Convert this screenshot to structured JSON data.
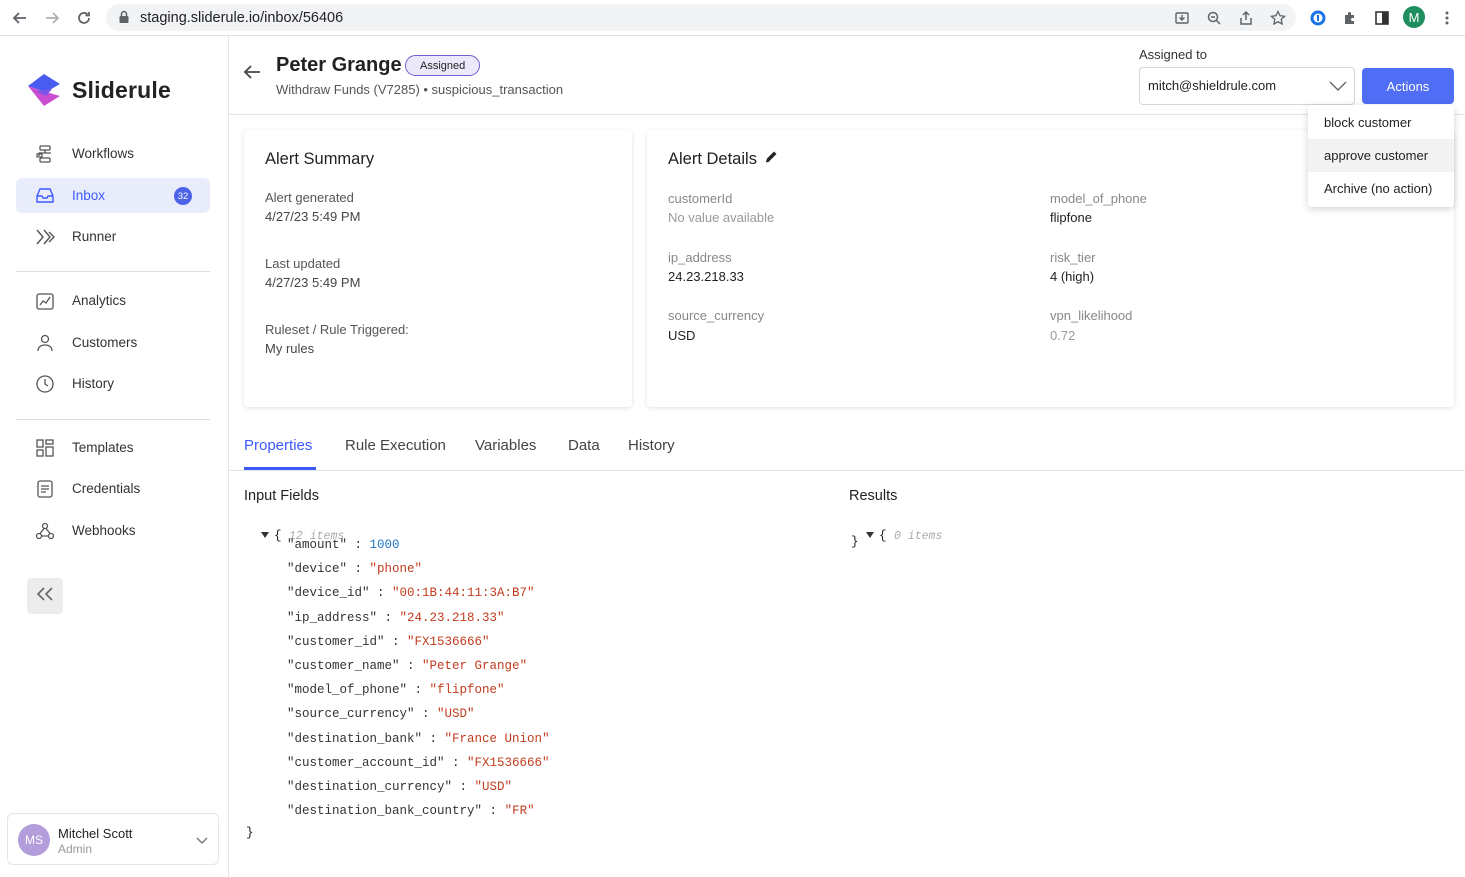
{
  "browser": {
    "url": "staging.sliderule.io/inbox/56406",
    "profile_initial": "M"
  },
  "sidebar": {
    "brand": "Sliderule",
    "groups": [
      [
        {
          "label": "Workflows",
          "icon": "workflows-icon"
        },
        {
          "label": "Inbox",
          "icon": "inbox-icon",
          "badge": "32",
          "active": true
        },
        {
          "label": "Runner",
          "icon": "runner-icon"
        }
      ],
      [
        {
          "label": "Analytics",
          "icon": "analytics-icon"
        },
        {
          "label": "Customers",
          "icon": "person-icon"
        },
        {
          "label": "History",
          "icon": "clock-icon"
        }
      ],
      [
        {
          "label": "Templates",
          "icon": "templates-icon"
        },
        {
          "label": "Credentials",
          "icon": "credentials-icon"
        },
        {
          "label": "Webhooks",
          "icon": "webhooks-icon"
        }
      ]
    ],
    "user": {
      "initials": "MS",
      "name": "Mitchel Scott",
      "role": "Admin"
    }
  },
  "header": {
    "title": "Peter Grange",
    "status": "Assigned",
    "subtitle": "Withdraw Funds (V7285) • suspicious_transaction",
    "assigned_label": "Assigned to",
    "assigned_value": "mitch@shieldrule.com",
    "actions_label": "Actions"
  },
  "actions_menu": [
    "block customer",
    "approve customer",
    "Archive (no action)"
  ],
  "alert_summary": {
    "title": "Alert Summary",
    "rows": [
      {
        "label": "Alert generated",
        "value": "4/27/23 5:49 PM"
      },
      {
        "label": "Last updated",
        "value": "4/27/23 5:49 PM"
      },
      {
        "label": "Ruleset / Rule Triggered:",
        "value": "My rules"
      }
    ]
  },
  "alert_details": {
    "title": "Alert Details",
    "left": [
      {
        "label": "customerId",
        "value": "No value available"
      },
      {
        "label": "ip_address",
        "value": "24.23.218.33"
      },
      {
        "label": "source_currency",
        "value": "USD"
      }
    ],
    "right": [
      {
        "label": "model_of_phone",
        "value": "flipfone"
      },
      {
        "label": "risk_tier",
        "value": "4 (high)"
      },
      {
        "label": "vpn_likelihood",
        "value": "0.72"
      }
    ]
  },
  "tabs": [
    "Properties",
    "Rule Execution",
    "Variables",
    "Data",
    "History"
  ],
  "input_fields": {
    "title": "Input Fields",
    "count": "12 items",
    "entries": [
      {
        "key": "\"amount\"",
        "value": "1000",
        "type": "num"
      },
      {
        "key": "\"device\"",
        "value": "\"phone\"",
        "type": "str"
      },
      {
        "key": "\"device_id\"",
        "value": "\"00:1B:44:11:3A:B7\"",
        "type": "str"
      },
      {
        "key": "\"ip_address\"",
        "value": "\"24.23.218.33\"",
        "type": "str"
      },
      {
        "key": "\"customer_id\"",
        "value": "\"FX1536666\"",
        "type": "str"
      },
      {
        "key": "\"customer_name\"",
        "value": "\"Peter Grange\"",
        "type": "str"
      },
      {
        "key": "\"model_of_phone\"",
        "value": "\"flipfone\"",
        "type": "str"
      },
      {
        "key": "\"source_currency\"",
        "value": "\"USD\"",
        "type": "str"
      },
      {
        "key": "\"destination_bank\"",
        "value": "\"France Union\"",
        "type": "str"
      },
      {
        "key": "\"customer_account_id\"",
        "value": "\"FX1536666\"",
        "type": "str"
      },
      {
        "key": "\"destination_currency\"",
        "value": "\"USD\"",
        "type": "str"
      },
      {
        "key": "\"destination_bank_country\"",
        "value": "\"FR\"",
        "type": "str"
      }
    ]
  },
  "results": {
    "title": "Results",
    "count": "0 items"
  },
  "colors": {
    "accent": "#3d5afe",
    "actions_button": "#4f6df5",
    "json_number": "#1e77c9",
    "json_string": "#c33c1e"
  }
}
